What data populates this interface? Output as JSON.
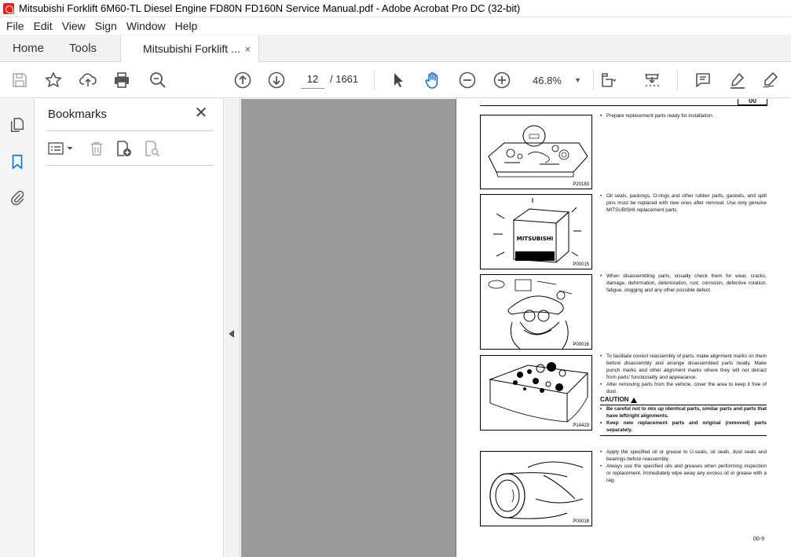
{
  "window": {
    "title": "Mitsubishi Forklift 6M60-TL Diesel Engine FD80N FD160N Service Manual.pdf - Adobe Acrobat Pro DC (32-bit)"
  },
  "menu": [
    "File",
    "Edit",
    "View",
    "Sign",
    "Window",
    "Help"
  ],
  "tabs": {
    "home": "Home",
    "tools": "Tools",
    "document": "Mitsubishi Forklift ...",
    "close_glyph": "×"
  },
  "toolbar": {
    "current_page": "12",
    "total_pages": "/  1661",
    "zoom": "46.8%",
    "icons": [
      "save-icon",
      "star-icon",
      "upload-icon",
      "print-icon",
      "zoom-search-icon",
      "page-up-icon",
      "page-down-icon",
      "pointer-icon",
      "hand-icon",
      "zoom-out-icon",
      "zoom-in-icon",
      "page-layout-icon",
      "scroll-mode-icon",
      "comment-icon",
      "highlight-icon",
      "sign-icon"
    ]
  },
  "bookmarks": {
    "title": "Bookmarks",
    "close_glyph": "✕"
  },
  "document_page": {
    "section": "00",
    "figures": [
      "P20183",
      "P00015",
      "P00016",
      "P14423",
      "P00018"
    ],
    "blocks": [
      [
        "Prepare replacement parts ready for installation."
      ],
      [
        "Oil seals, packings, O-rings and other rubber parts, gaskets, and split pins must be replaced with new ones after removal. Use only genuine MITSUBISHI replacement parts."
      ],
      [
        "When disassembling parts, visually check them for wear, cracks, damage, deformation, deterioration, rust, corrosion, defective rotation, fatigue, clogging and any other possible defect."
      ],
      [
        "To facilitate correct reassembly of parts, make alignment marks on them before disassembly and arrange disassembled parts neatly. Make punch marks and other alignment marks where they will not detract from parts' functionality and appearance.",
        "After removing parts from the vehicle, cover the area to keep it free of dust."
      ],
      [
        "Apply the specified oil or grease to U-seals, oil seals, dust seals and bearings before reassembly.",
        "Always use the specified oils and greases when performing inspection or replacement. Immediately wipe away any excess oil or grease with a rag."
      ]
    ],
    "caution": {
      "heading": "CAUTION",
      "items": [
        "Be careful not to mix up identical parts, similar parts and parts that have left/right alignments.",
        "Keep new replacement parts and original (removed) parts separately."
      ]
    },
    "box_label": "MITSUBISHI",
    "page_number": "00-9"
  }
}
